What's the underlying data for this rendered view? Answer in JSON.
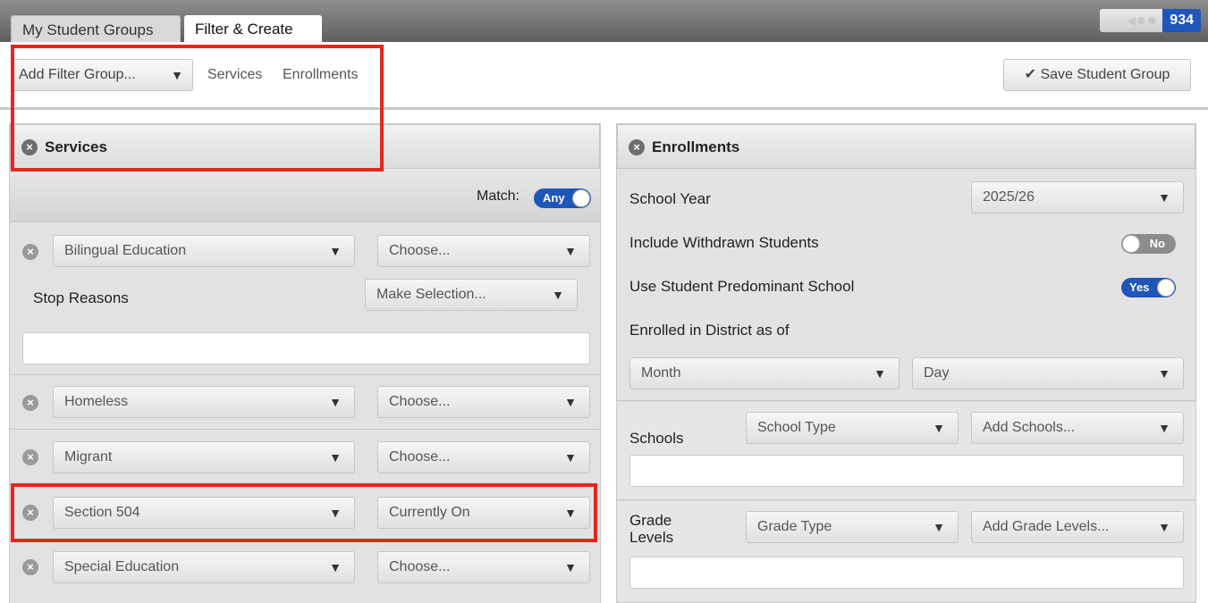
{
  "tabs": [
    {
      "label": "My Student Groups"
    },
    {
      "label": "Filter & Create"
    }
  ],
  "counter": {
    "count": "934",
    "icon": "people-icon",
    "prev_icon": "chevron-left-icon"
  },
  "toolbar": {
    "add_filter_label": "Add Filter Group...",
    "links": [
      "Services",
      "Enrollments"
    ],
    "save_label": "Save Student Group",
    "save_icon": "checkmark-icon"
  },
  "services": {
    "title": "Services",
    "match_label": "Match:",
    "match_value": "Any",
    "filters": [
      {
        "name": "Bilingual Education",
        "value": "Choose..."
      },
      {
        "name": "Homeless",
        "value": "Choose..."
      },
      {
        "name": "Migrant",
        "value": "Choose..."
      },
      {
        "name": "Section 504",
        "value": "Currently On"
      },
      {
        "name": "Special Education",
        "value": "Choose..."
      }
    ],
    "stop_reasons_label": "Stop Reasons",
    "stop_reasons_value": "Make Selection..."
  },
  "enrollments": {
    "title": "Enrollments",
    "school_year_label": "School Year",
    "school_year_value": "2025/26",
    "withdrawn_label": "Include Withdrawn Students",
    "withdrawn_value": "No",
    "predominant_label": "Use Student Predominant School",
    "predominant_value": "Yes",
    "enrolled_label": "Enrolled in District as of",
    "month_label": "Month",
    "day_label": "Day",
    "schools_label": "Schools",
    "school_type_label": "School Type",
    "add_schools_label": "Add Schools...",
    "grade_levels_label": "Grade Levels",
    "grade_type_label": "Grade Type",
    "add_grades_label": "Add Grade Levels..."
  },
  "colors": {
    "accent": "#1f56b8",
    "highlight": "#e8261c"
  }
}
